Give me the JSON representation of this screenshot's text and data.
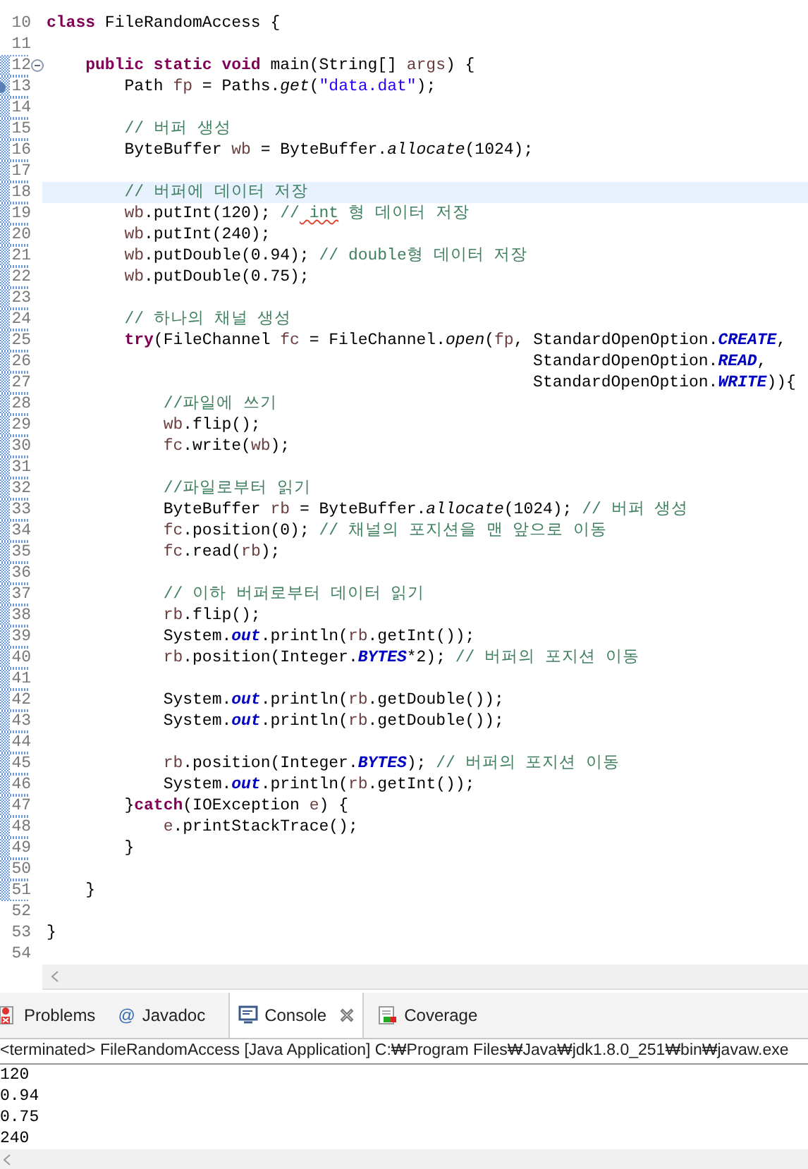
{
  "editor": {
    "lines": [
      {
        "number": "10",
        "tokens": [
          {
            "kind": "kw",
            "text": "class"
          },
          {
            "kind": "p",
            "text": " FileRandomAccess {"
          }
        ]
      },
      {
        "number": "11"
      },
      {
        "number": "12",
        "marked": true,
        "expanded": true,
        "tokens": [
          {
            "kind": "kw",
            "text": "    public static void"
          },
          {
            "kind": "p",
            "text": " main(String[] "
          },
          {
            "kind": "var",
            "text": "args"
          },
          {
            "kind": "p",
            "text": ") {"
          }
        ]
      },
      {
        "number": "13",
        "marked": true,
        "marker": true,
        "tokens": [
          {
            "kind": "p",
            "text": "        Path "
          },
          {
            "kind": "var",
            "text": "fp"
          },
          {
            "kind": "p",
            "text": " = Paths."
          },
          {
            "kind": "sm",
            "text": "get"
          },
          {
            "kind": "p",
            "text": "("
          },
          {
            "kind": "str",
            "text": "\"data.dat\""
          },
          {
            "kind": "p",
            "text": ");"
          }
        ]
      },
      {
        "number": "14",
        "marked": true
      },
      {
        "number": "15",
        "marked": true,
        "tokens": [
          {
            "kind": "cm",
            "text": "        // 버퍼 생성"
          }
        ]
      },
      {
        "number": "16",
        "marked": true,
        "tokens": [
          {
            "kind": "p",
            "text": "        ByteBuffer "
          },
          {
            "kind": "var",
            "text": "wb"
          },
          {
            "kind": "p",
            "text": " = ByteBuffer."
          },
          {
            "kind": "sm",
            "text": "allocate"
          },
          {
            "kind": "p",
            "text": "(1024);"
          }
        ]
      },
      {
        "number": "17",
        "marked": true
      },
      {
        "number": "18",
        "marked": true,
        "highlighted": true,
        "tokens": [
          {
            "kind": "cm",
            "text": "        // 버퍼에 데이터 저장"
          }
        ]
      },
      {
        "number": "19",
        "marked": true,
        "tokens": [
          {
            "kind": "var",
            "text": "        wb"
          },
          {
            "kind": "p",
            "text": ".putInt(120); "
          },
          {
            "kind": "cm",
            "text": "//"
          },
          {
            "kind": "typo",
            "text": " int"
          },
          {
            "kind": "cm",
            "text": " 형 데이터 저장"
          }
        ]
      },
      {
        "number": "20",
        "marked": true,
        "tokens": [
          {
            "kind": "var",
            "text": "        wb"
          },
          {
            "kind": "p",
            "text": ".putInt(240);"
          }
        ]
      },
      {
        "number": "21",
        "marked": true,
        "tokens": [
          {
            "kind": "var",
            "text": "        wb"
          },
          {
            "kind": "p",
            "text": ".putDouble(0.94); "
          },
          {
            "kind": "cm",
            "text": "// double형 데이터 저장"
          }
        ]
      },
      {
        "number": "22",
        "marked": true,
        "tokens": [
          {
            "kind": "var",
            "text": "        wb"
          },
          {
            "kind": "p",
            "text": ".putDouble(0.75);"
          }
        ]
      },
      {
        "number": "23",
        "marked": true
      },
      {
        "number": "24",
        "marked": true,
        "tokens": [
          {
            "kind": "cm",
            "text": "        // 하나의 채널 생성"
          }
        ]
      },
      {
        "number": "25",
        "marked": true,
        "tokens": [
          {
            "kind": "kw",
            "text": "        try"
          },
          {
            "kind": "p",
            "text": "(FileChannel "
          },
          {
            "kind": "var",
            "text": "fc"
          },
          {
            "kind": "p",
            "text": " = FileChannel."
          },
          {
            "kind": "sm",
            "text": "open"
          },
          {
            "kind": "p",
            "text": "("
          },
          {
            "kind": "var",
            "text": "fp"
          },
          {
            "kind": "p",
            "text": ", StandardOpenOption."
          },
          {
            "kind": "sf",
            "text": "CREATE"
          },
          {
            "kind": "p",
            "text": ","
          }
        ]
      },
      {
        "number": "26",
        "marked": true,
        "tokens": [
          {
            "kind": "p",
            "text": "                                                  StandardOpenOption."
          },
          {
            "kind": "sf",
            "text": "READ"
          },
          {
            "kind": "p",
            "text": ","
          }
        ]
      },
      {
        "number": "27",
        "marked": true,
        "tokens": [
          {
            "kind": "p",
            "text": "                                                  StandardOpenOption."
          },
          {
            "kind": "sf",
            "text": "WRITE"
          },
          {
            "kind": "p",
            "text": ")){"
          }
        ]
      },
      {
        "number": "28",
        "marked": true,
        "tokens": [
          {
            "kind": "cm",
            "text": "            //파일에 쓰기"
          }
        ]
      },
      {
        "number": "29",
        "marked": true,
        "tokens": [
          {
            "kind": "var",
            "text": "            wb"
          },
          {
            "kind": "p",
            "text": ".flip();"
          }
        ]
      },
      {
        "number": "30",
        "marked": true,
        "tokens": [
          {
            "kind": "var",
            "text": "            fc"
          },
          {
            "kind": "p",
            "text": ".write("
          },
          {
            "kind": "var",
            "text": "wb"
          },
          {
            "kind": "p",
            "text": ");"
          }
        ]
      },
      {
        "number": "31",
        "marked": true
      },
      {
        "number": "32",
        "marked": true,
        "tokens": [
          {
            "kind": "cm",
            "text": "            //파일로부터 읽기"
          }
        ]
      },
      {
        "number": "33",
        "marked": true,
        "tokens": [
          {
            "kind": "p",
            "text": "            ByteBuffer "
          },
          {
            "kind": "var",
            "text": "rb"
          },
          {
            "kind": "p",
            "text": " = ByteBuffer."
          },
          {
            "kind": "sm",
            "text": "allocate"
          },
          {
            "kind": "p",
            "text": "(1024); "
          },
          {
            "kind": "cm",
            "text": "// 버퍼 생성"
          }
        ]
      },
      {
        "number": "34",
        "marked": true,
        "tokens": [
          {
            "kind": "var",
            "text": "            fc"
          },
          {
            "kind": "p",
            "text": ".position(0); "
          },
          {
            "kind": "cm",
            "text": "// 채널의 포지션을 맨 앞으로 이동"
          }
        ]
      },
      {
        "number": "35",
        "marked": true,
        "tokens": [
          {
            "kind": "var",
            "text": "            fc"
          },
          {
            "kind": "p",
            "text": ".read("
          },
          {
            "kind": "var",
            "text": "rb"
          },
          {
            "kind": "p",
            "text": ");"
          }
        ]
      },
      {
        "number": "36",
        "marked": true
      },
      {
        "number": "37",
        "marked": true,
        "tokens": [
          {
            "kind": "cm",
            "text": "            // 이하 버퍼로부터 데이터 읽기"
          }
        ]
      },
      {
        "number": "38",
        "marked": true,
        "tokens": [
          {
            "kind": "var",
            "text": "            rb"
          },
          {
            "kind": "p",
            "text": ".flip();"
          }
        ]
      },
      {
        "number": "39",
        "marked": true,
        "tokens": [
          {
            "kind": "p",
            "text": "            System."
          },
          {
            "kind": "sf",
            "text": "out"
          },
          {
            "kind": "p",
            "text": ".println("
          },
          {
            "kind": "var",
            "text": "rb"
          },
          {
            "kind": "p",
            "text": ".getInt());"
          }
        ]
      },
      {
        "number": "40",
        "marked": true,
        "tokens": [
          {
            "kind": "var",
            "text": "            rb"
          },
          {
            "kind": "p",
            "text": ".position(Integer."
          },
          {
            "kind": "sf",
            "text": "BYTES"
          },
          {
            "kind": "p",
            "text": "*2); "
          },
          {
            "kind": "cm",
            "text": "// 버퍼의 포지션 이동"
          }
        ]
      },
      {
        "number": "41",
        "marked": true
      },
      {
        "number": "42",
        "marked": true,
        "tokens": [
          {
            "kind": "p",
            "text": "            System."
          },
          {
            "kind": "sf",
            "text": "out"
          },
          {
            "kind": "p",
            "text": ".println("
          },
          {
            "kind": "var",
            "text": "rb"
          },
          {
            "kind": "p",
            "text": ".getDouble());"
          }
        ]
      },
      {
        "number": "43",
        "marked": true,
        "tokens": [
          {
            "kind": "p",
            "text": "            System."
          },
          {
            "kind": "sf",
            "text": "out"
          },
          {
            "kind": "p",
            "text": ".println("
          },
          {
            "kind": "var",
            "text": "rb"
          },
          {
            "kind": "p",
            "text": ".getDouble());"
          }
        ]
      },
      {
        "number": "44",
        "marked": true
      },
      {
        "number": "45",
        "marked": true,
        "tokens": [
          {
            "kind": "var",
            "text": "            rb"
          },
          {
            "kind": "p",
            "text": ".position(Integer."
          },
          {
            "kind": "sf",
            "text": "BYTES"
          },
          {
            "kind": "p",
            "text": "); "
          },
          {
            "kind": "cm",
            "text": "// 버퍼의 포지션 이동"
          }
        ]
      },
      {
        "number": "46",
        "marked": true,
        "tokens": [
          {
            "kind": "p",
            "text": "            System."
          },
          {
            "kind": "sf",
            "text": "out"
          },
          {
            "kind": "p",
            "text": ".println("
          },
          {
            "kind": "var",
            "text": "rb"
          },
          {
            "kind": "p",
            "text": ".getInt());"
          }
        ]
      },
      {
        "number": "47",
        "marked": true,
        "tokens": [
          {
            "kind": "p",
            "text": "        }"
          },
          {
            "kind": "kw",
            "text": "catch"
          },
          {
            "kind": "p",
            "text": "(IOException "
          },
          {
            "kind": "var",
            "text": "e"
          },
          {
            "kind": "p",
            "text": ") {"
          }
        ]
      },
      {
        "number": "48",
        "marked": true,
        "tokens": [
          {
            "kind": "var",
            "text": "            e"
          },
          {
            "kind": "p",
            "text": ".printStackTrace();"
          }
        ]
      },
      {
        "number": "49",
        "marked": true,
        "tokens": [
          {
            "kind": "p",
            "text": "        }"
          }
        ]
      },
      {
        "number": "50",
        "marked": true
      },
      {
        "number": "51",
        "marked": true,
        "tokens": [
          {
            "kind": "p",
            "text": "    }"
          }
        ]
      },
      {
        "number": "52"
      },
      {
        "number": "53",
        "tokens": [
          {
            "kind": "p",
            "text": "}"
          }
        ]
      },
      {
        "number": "54"
      }
    ]
  },
  "tabs": [
    {
      "kind": "problems",
      "label": "Problems",
      "selected": false
    },
    {
      "kind": "javadoc",
      "glyph": "@",
      "label": "Javadoc",
      "selected": false
    },
    {
      "kind": "console",
      "label": "Console",
      "selected": true
    },
    {
      "kind": "coverage",
      "label": "Coverage",
      "selected": false
    }
  ],
  "console": {
    "header": "<terminated> FileRandomAccess [Java Application] C:₩Program Files₩Java₩jdk1.8.0_251₩bin₩javaw.exe",
    "output": [
      "120",
      "0.94",
      "0.75",
      "240"
    ]
  }
}
